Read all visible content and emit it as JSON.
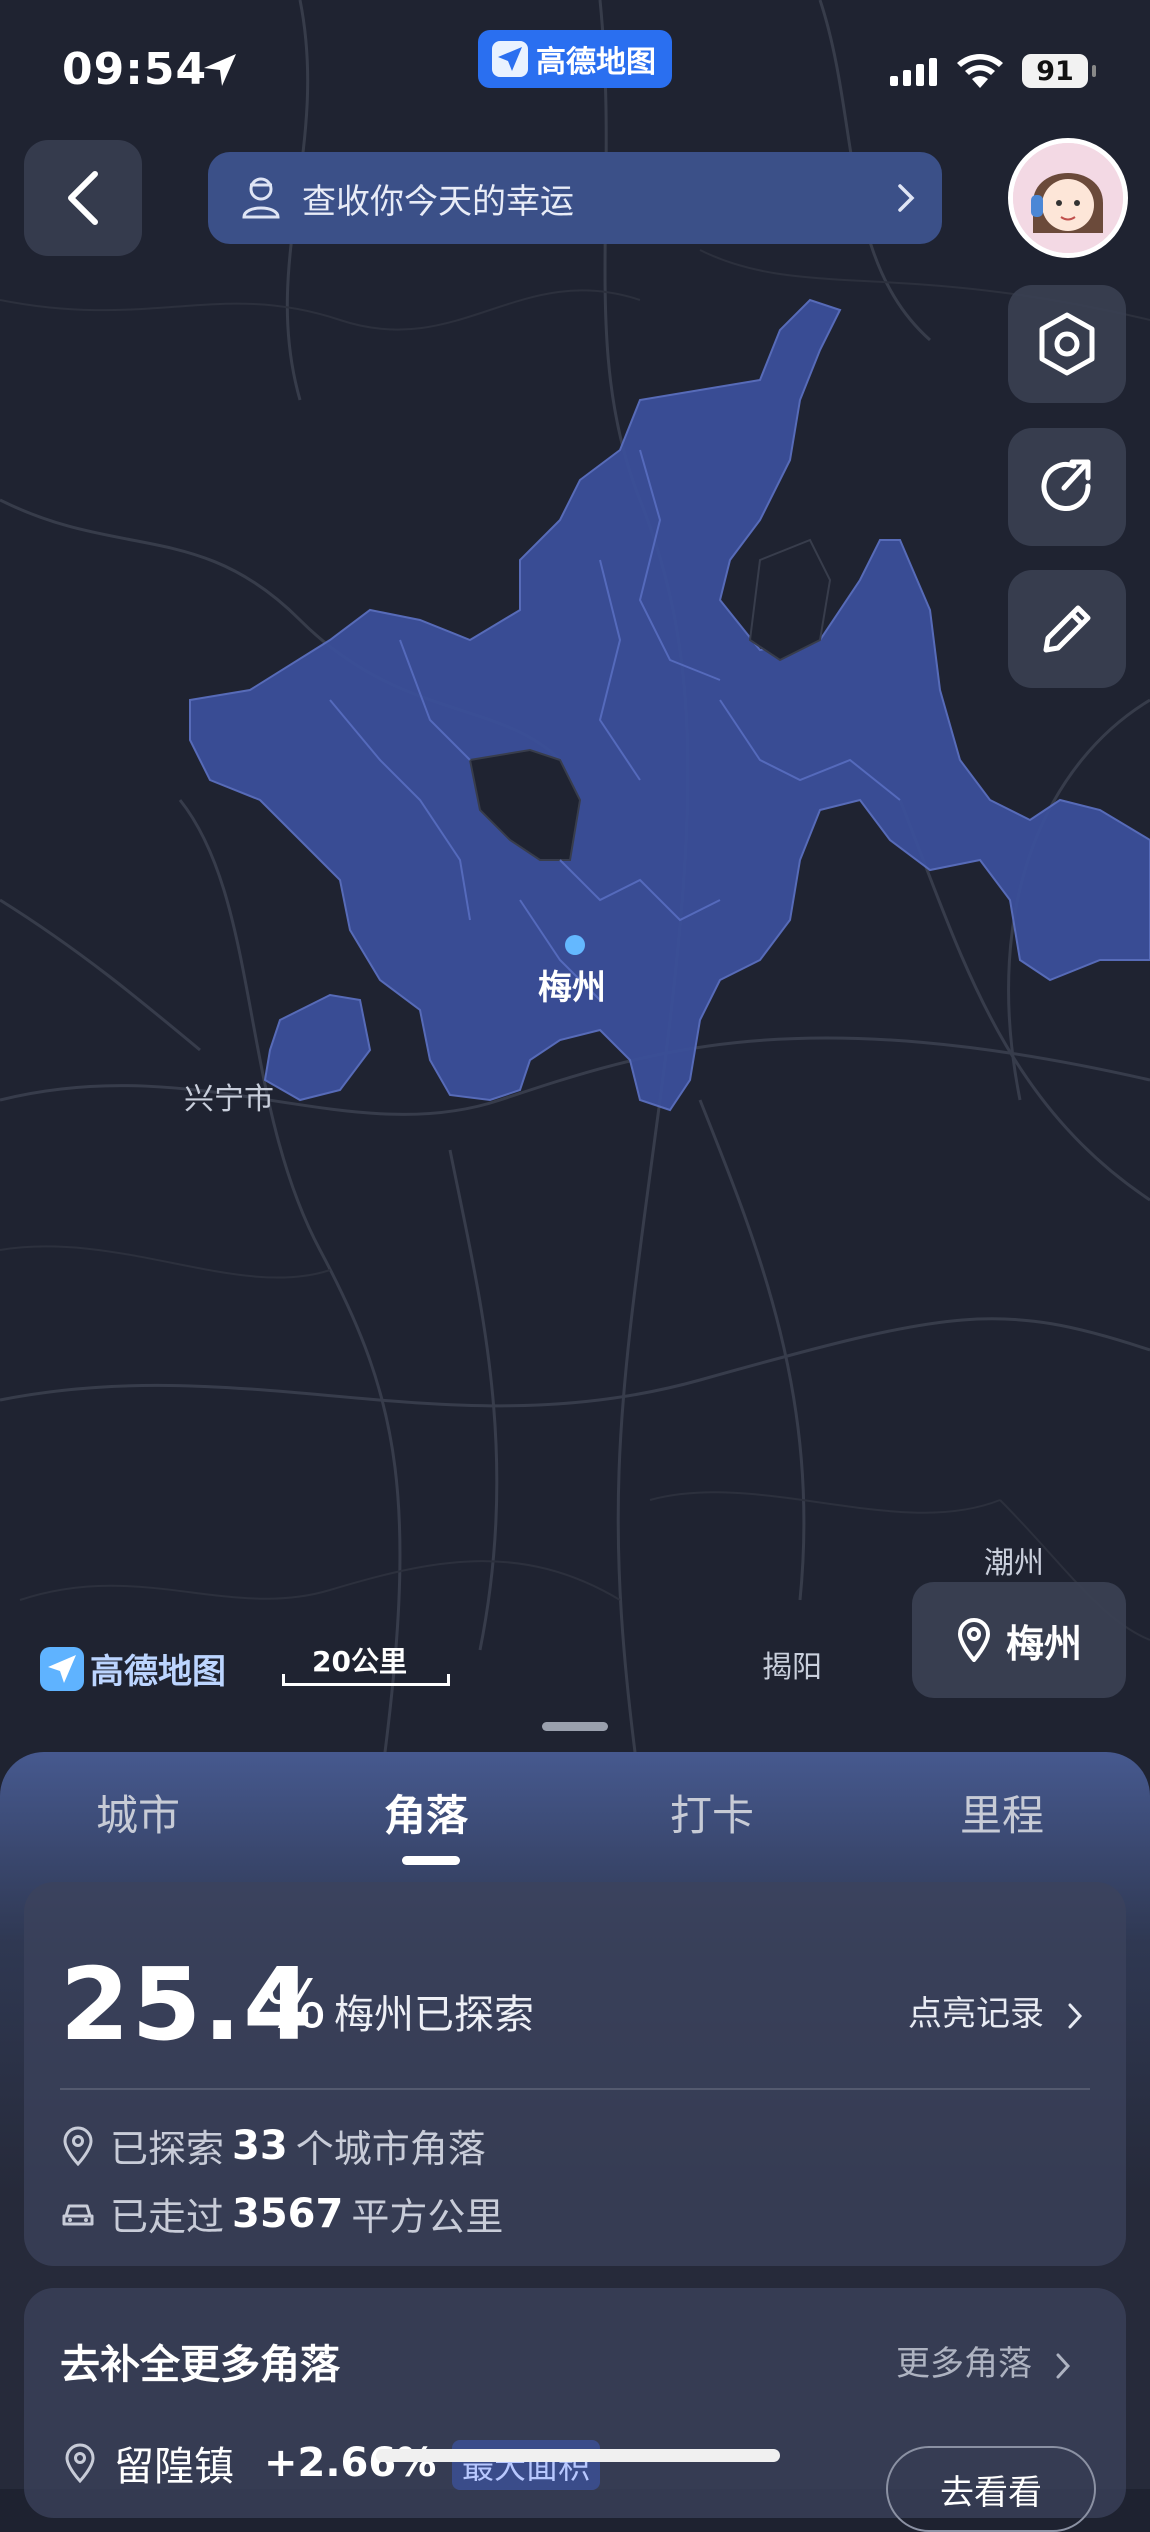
{
  "status_bar": {
    "time": "09:54",
    "app_name": "高德地图",
    "battery": "91"
  },
  "header": {
    "fortune_text": "查收你今天的幸运"
  },
  "map": {
    "city_label": "梅州",
    "labels": [
      {
        "text": "兴宁市"
      },
      {
        "text": "潮州"
      },
      {
        "text": "揭阳"
      }
    ],
    "logo_text": "高德地图",
    "scale_text": "20公里",
    "city_button": "梅州",
    "explored_color": "#3b4f9a"
  },
  "tabs": [
    "城市",
    "角落",
    "打卡",
    "里程"
  ],
  "active_tab": 1,
  "summary": {
    "percent": "25.4",
    "percent_sign": "%",
    "explored_text": "梅州已探索",
    "light_record": "点亮记录",
    "corners_prefix": "已探索",
    "corners_count": "33",
    "corners_suffix": "个城市角落",
    "area_prefix": "已走过",
    "area_value": "3567",
    "area_suffix": "平方公里"
  },
  "more": {
    "title": "去补全更多角落",
    "link": "更多角落",
    "town": "留隍镇",
    "increase": "+2.66%",
    "badge": "最大面积",
    "go_button": "去看看"
  }
}
